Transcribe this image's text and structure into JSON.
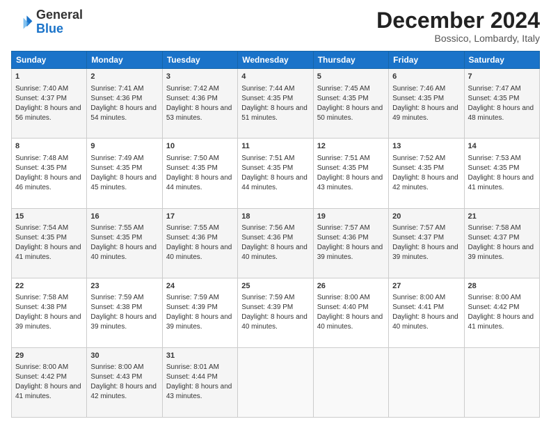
{
  "logo": {
    "general": "General",
    "blue": "Blue"
  },
  "title": "December 2024",
  "location": "Bossico, Lombardy, Italy",
  "headers": [
    "Sunday",
    "Monday",
    "Tuesday",
    "Wednesday",
    "Thursday",
    "Friday",
    "Saturday"
  ],
  "weeks": [
    [
      {
        "day": "1",
        "sunrise": "7:40 AM",
        "sunset": "4:37 PM",
        "daylight": "8 hours and 56 minutes."
      },
      {
        "day": "2",
        "sunrise": "7:41 AM",
        "sunset": "4:36 PM",
        "daylight": "8 hours and 54 minutes."
      },
      {
        "day": "3",
        "sunrise": "7:42 AM",
        "sunset": "4:36 PM",
        "daylight": "8 hours and 53 minutes."
      },
      {
        "day": "4",
        "sunrise": "7:44 AM",
        "sunset": "4:35 PM",
        "daylight": "8 hours and 51 minutes."
      },
      {
        "day": "5",
        "sunrise": "7:45 AM",
        "sunset": "4:35 PM",
        "daylight": "8 hours and 50 minutes."
      },
      {
        "day": "6",
        "sunrise": "7:46 AM",
        "sunset": "4:35 PM",
        "daylight": "8 hours and 49 minutes."
      },
      {
        "day": "7",
        "sunrise": "7:47 AM",
        "sunset": "4:35 PM",
        "daylight": "8 hours and 48 minutes."
      }
    ],
    [
      {
        "day": "8",
        "sunrise": "7:48 AM",
        "sunset": "4:35 PM",
        "daylight": "8 hours and 46 minutes."
      },
      {
        "day": "9",
        "sunrise": "7:49 AM",
        "sunset": "4:35 PM",
        "daylight": "8 hours and 45 minutes."
      },
      {
        "day": "10",
        "sunrise": "7:50 AM",
        "sunset": "4:35 PM",
        "daylight": "8 hours and 44 minutes."
      },
      {
        "day": "11",
        "sunrise": "7:51 AM",
        "sunset": "4:35 PM",
        "daylight": "8 hours and 44 minutes."
      },
      {
        "day": "12",
        "sunrise": "7:51 AM",
        "sunset": "4:35 PM",
        "daylight": "8 hours and 43 minutes."
      },
      {
        "day": "13",
        "sunrise": "7:52 AM",
        "sunset": "4:35 PM",
        "daylight": "8 hours and 42 minutes."
      },
      {
        "day": "14",
        "sunrise": "7:53 AM",
        "sunset": "4:35 PM",
        "daylight": "8 hours and 41 minutes."
      }
    ],
    [
      {
        "day": "15",
        "sunrise": "7:54 AM",
        "sunset": "4:35 PM",
        "daylight": "8 hours and 41 minutes."
      },
      {
        "day": "16",
        "sunrise": "7:55 AM",
        "sunset": "4:35 PM",
        "daylight": "8 hours and 40 minutes."
      },
      {
        "day": "17",
        "sunrise": "7:55 AM",
        "sunset": "4:36 PM",
        "daylight": "8 hours and 40 minutes."
      },
      {
        "day": "18",
        "sunrise": "7:56 AM",
        "sunset": "4:36 PM",
        "daylight": "8 hours and 40 minutes."
      },
      {
        "day": "19",
        "sunrise": "7:57 AM",
        "sunset": "4:36 PM",
        "daylight": "8 hours and 39 minutes."
      },
      {
        "day": "20",
        "sunrise": "7:57 AM",
        "sunset": "4:37 PM",
        "daylight": "8 hours and 39 minutes."
      },
      {
        "day": "21",
        "sunrise": "7:58 AM",
        "sunset": "4:37 PM",
        "daylight": "8 hours and 39 minutes."
      }
    ],
    [
      {
        "day": "22",
        "sunrise": "7:58 AM",
        "sunset": "4:38 PM",
        "daylight": "8 hours and 39 minutes."
      },
      {
        "day": "23",
        "sunrise": "7:59 AM",
        "sunset": "4:38 PM",
        "daylight": "8 hours and 39 minutes."
      },
      {
        "day": "24",
        "sunrise": "7:59 AM",
        "sunset": "4:39 PM",
        "daylight": "8 hours and 39 minutes."
      },
      {
        "day": "25",
        "sunrise": "7:59 AM",
        "sunset": "4:39 PM",
        "daylight": "8 hours and 40 minutes."
      },
      {
        "day": "26",
        "sunrise": "8:00 AM",
        "sunset": "4:40 PM",
        "daylight": "8 hours and 40 minutes."
      },
      {
        "day": "27",
        "sunrise": "8:00 AM",
        "sunset": "4:41 PM",
        "daylight": "8 hours and 40 minutes."
      },
      {
        "day": "28",
        "sunrise": "8:00 AM",
        "sunset": "4:42 PM",
        "daylight": "8 hours and 41 minutes."
      }
    ],
    [
      {
        "day": "29",
        "sunrise": "8:00 AM",
        "sunset": "4:42 PM",
        "daylight": "8 hours and 41 minutes."
      },
      {
        "day": "30",
        "sunrise": "8:00 AM",
        "sunset": "4:43 PM",
        "daylight": "8 hours and 42 minutes."
      },
      {
        "day": "31",
        "sunrise": "8:01 AM",
        "sunset": "4:44 PM",
        "daylight": "8 hours and 43 minutes."
      },
      null,
      null,
      null,
      null
    ]
  ],
  "labels": {
    "sunrise": "Sunrise:",
    "sunset": "Sunset:",
    "daylight": "Daylight:"
  }
}
